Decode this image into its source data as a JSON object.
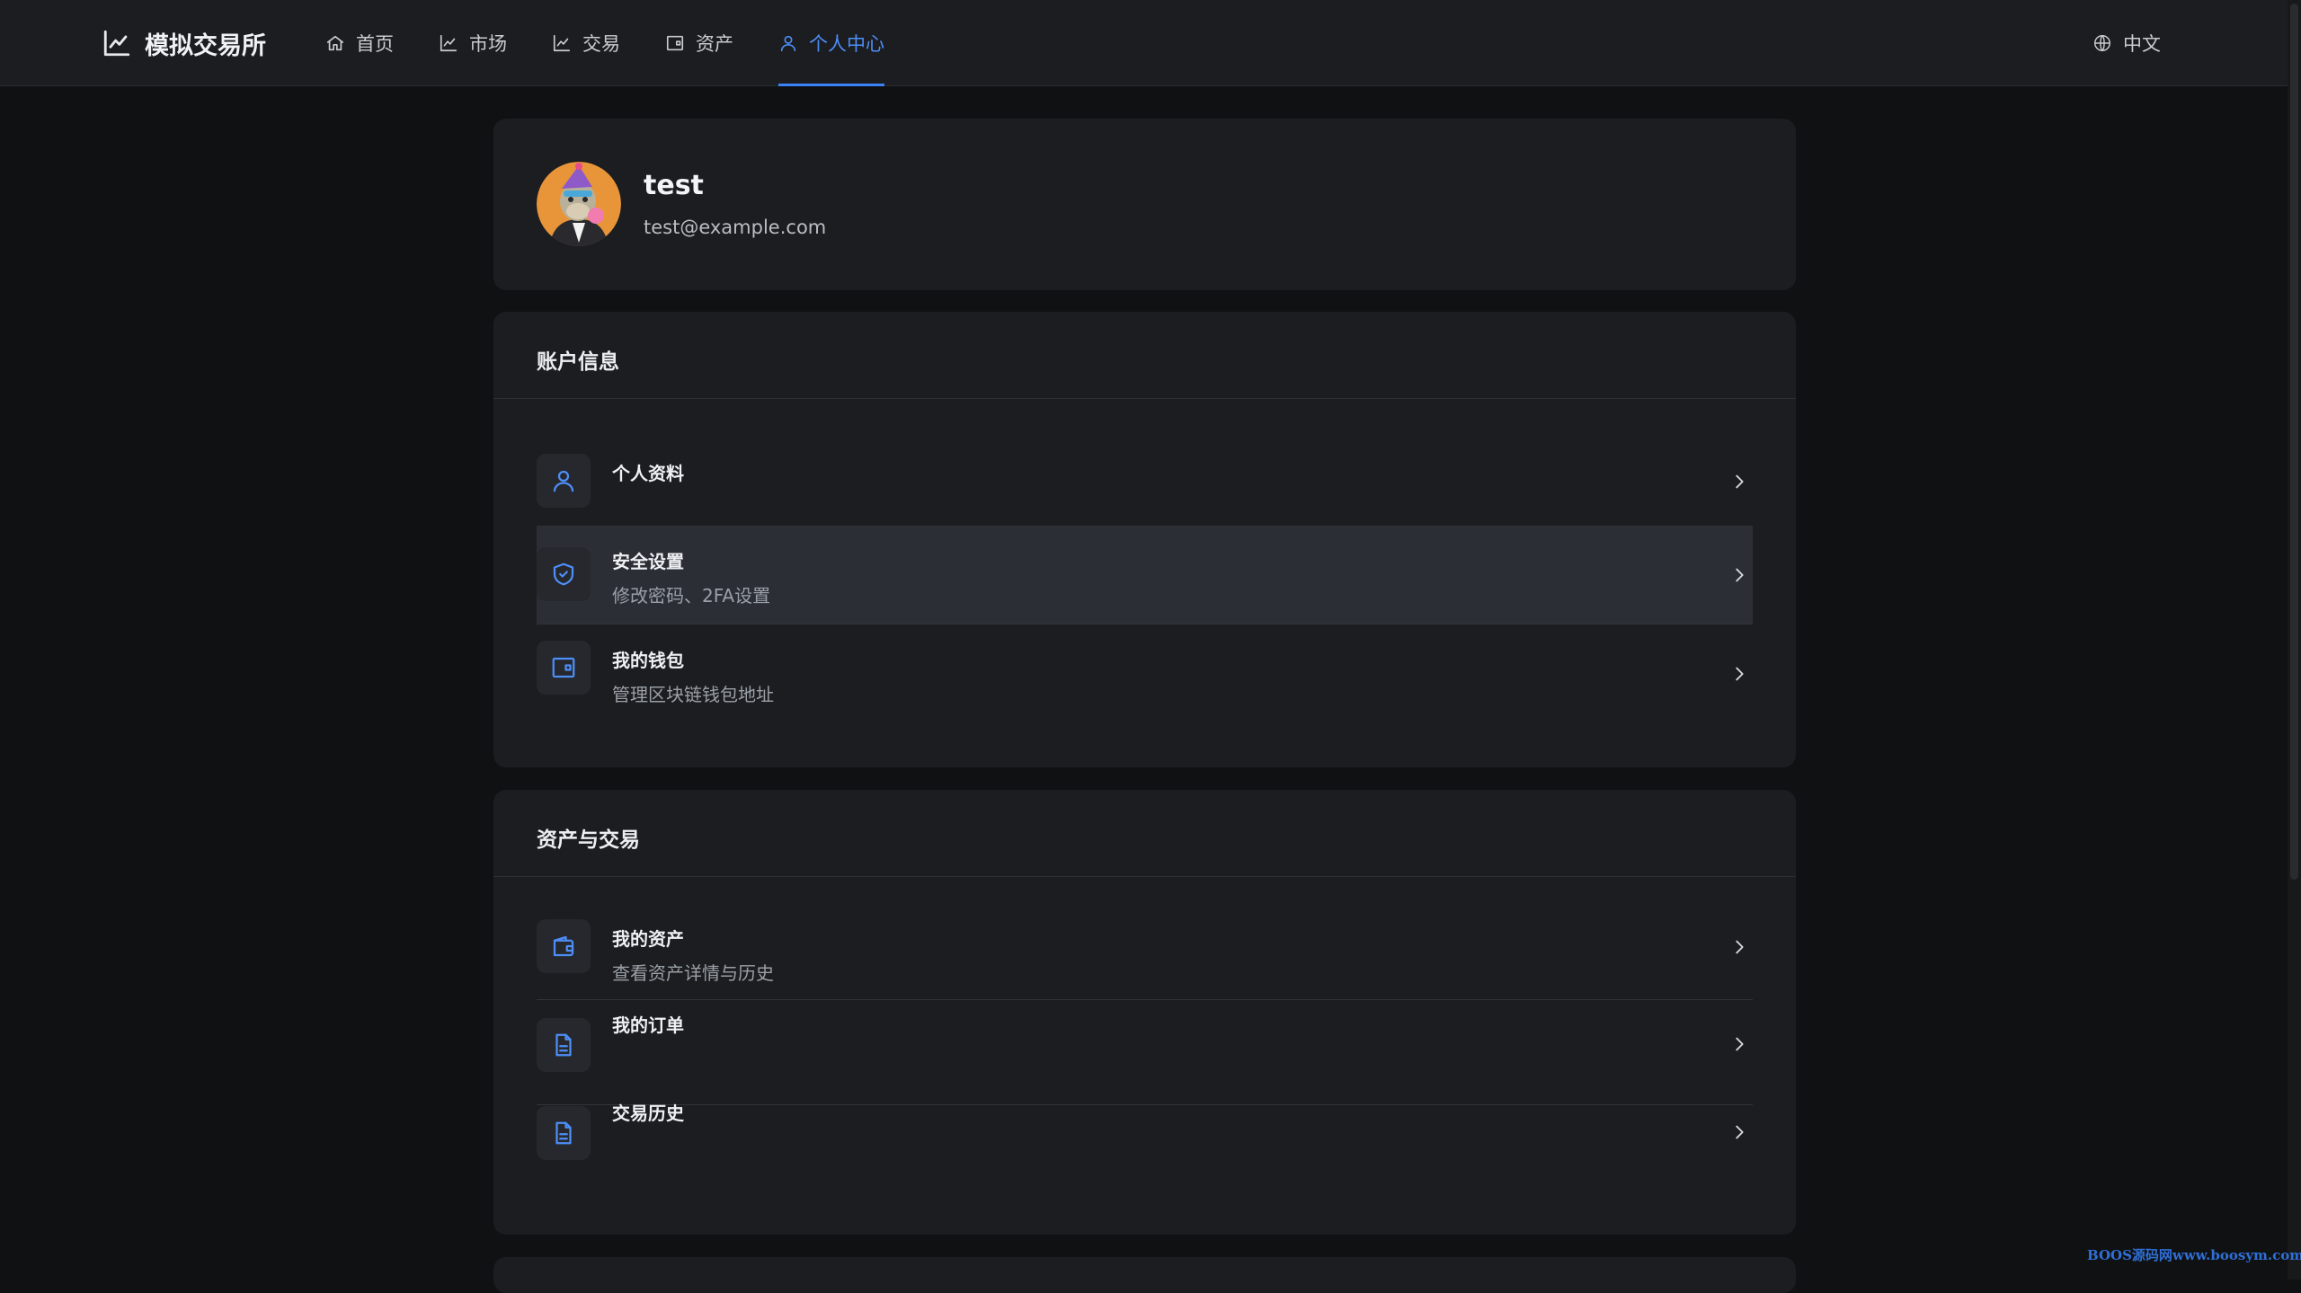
{
  "app": {
    "name": "模拟交易所",
    "language": "中文"
  },
  "nav": {
    "items": [
      {
        "label": "首页",
        "icon": "home-icon"
      },
      {
        "label": "市场",
        "icon": "chart-line-icon"
      },
      {
        "label": "交易",
        "icon": "chart-line-icon"
      },
      {
        "label": "资产",
        "icon": "wallet-icon"
      },
      {
        "label": "个人中心",
        "icon": "user-icon",
        "active": true
      }
    ]
  },
  "profile": {
    "username": "test",
    "email": "test@example.com"
  },
  "account_section": {
    "title": "账户信息",
    "items": [
      {
        "title": "个人资料",
        "subtitle": "",
        "icon": "user-icon"
      },
      {
        "title": "安全设置",
        "subtitle": "修改密码、2FA设置",
        "icon": "shield-icon",
        "highlighted": true
      },
      {
        "title": "我的钱包",
        "subtitle": "管理区块链钱包地址",
        "icon": "wallet-icon"
      }
    ]
  },
  "assets_section": {
    "title": "资产与交易",
    "items": [
      {
        "title": "我的资产",
        "subtitle": "查看资产详情与历史",
        "icon": "wallet-icon"
      },
      {
        "title": "我的订单",
        "subtitle": "",
        "icon": "document-icon"
      },
      {
        "title": "交易历史",
        "subtitle": "",
        "icon": "document-icon"
      }
    ]
  },
  "watermark": "BOOS源码网www.boosym.com",
  "colors": {
    "accent": "#3b82f6",
    "background": "#101113",
    "card": "#1c1d20",
    "navbar": "#1c1d20"
  }
}
